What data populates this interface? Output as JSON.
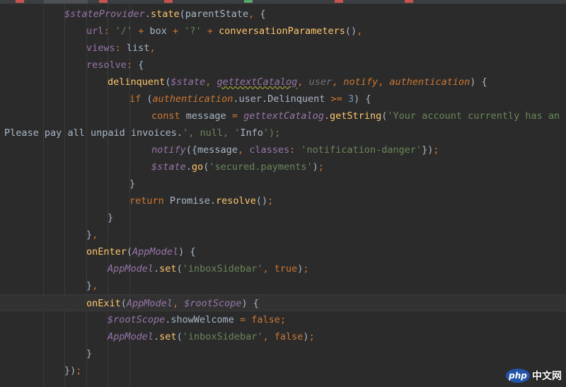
{
  "tabs": [
    {
      "label": "",
      "icon": "js-file-icon"
    },
    {
      "label": "",
      "icon": "js-file-icon"
    },
    {
      "label": "",
      "icon": "js-file-icon"
    },
    {
      "label": "",
      "icon": "html-file-icon"
    },
    {
      "label": "",
      "icon": "js-file-icon"
    },
    {
      "label": "",
      "icon": "js-file-icon"
    }
  ],
  "code_lines": [
    "$stateProvider.state(parentState, {",
    "url: '/' + box + '?' + conversationParameters(),",
    "views: list,",
    "resolve: {",
    "delinquent($state, gettextCatalog, user, notify, authentication) {",
    "if (authentication.user.Delinquent >= 3) {",
    "const message = gettextCatalog.getString('Your account currently has an over",
    "Please pay all unpaid invoices.', null, 'Info');",
    "notify({message, classes: 'notification-danger'});",
    "$state.go('secured.payments');",
    "}",
    "return Promise.resolve();",
    "}",
    "},",
    "onEnter(AppModel) {",
    "AppModel.set('inboxSidebar', true);",
    "},",
    "onExit(AppModel, $rootScope) {",
    "$rootScope.showWelcome = false;",
    "AppModel.set('inboxSidebar', false);",
    "}",
    "});"
  ],
  "watermark": {
    "badge": "php",
    "text": "中文网"
  },
  "colors": {
    "background": "#2b2b2b",
    "keyword": "#cc7832",
    "function": "#ffc66d",
    "string": "#6a8759",
    "number": "#6897bb",
    "global": "#9876aa",
    "plain": "#a9b7c6"
  }
}
